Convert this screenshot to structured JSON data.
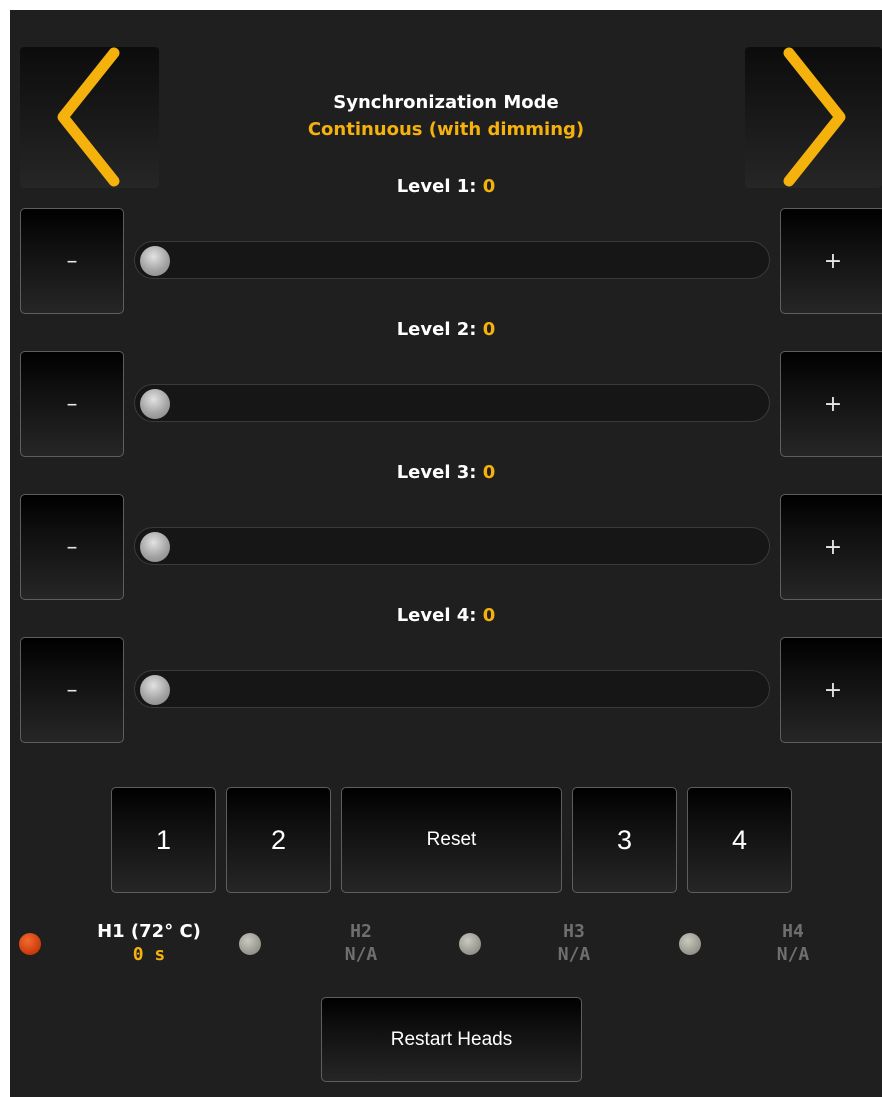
{
  "header": {
    "title": "Synchronization Mode",
    "mode": "Continuous (with dimming)"
  },
  "nav": {
    "prev_icon": "chevron-left-icon",
    "next_icon": "chevron-right-icon",
    "accent_color": "#f5b10c"
  },
  "levels": [
    {
      "label": "Level 1: ",
      "value": "0",
      "position": 0
    },
    {
      "label": "Level 2: ",
      "value": "0",
      "position": 0
    },
    {
      "label": "Level 3: ",
      "value": "0",
      "position": 0
    },
    {
      "label": "Level 4: ",
      "value": "0",
      "position": 0
    }
  ],
  "stepper": {
    "minus": "–",
    "plus": "+"
  },
  "presets": {
    "p1": "1",
    "p2": "2",
    "reset": "Reset",
    "p3": "3",
    "p4": "4"
  },
  "heads": [
    {
      "name": "H1 (72° C)",
      "value": "0 s",
      "status": "active",
      "status_color": "#d8420f"
    },
    {
      "name": "H2",
      "value": "N/A",
      "status": "inactive",
      "status_color": "#a8a89e"
    },
    {
      "name": "H3",
      "value": "N/A",
      "status": "inactive",
      "status_color": "#a8a89e"
    },
    {
      "name": "H4",
      "value": "N/A",
      "status": "inactive",
      "status_color": "#a8a89e"
    }
  ],
  "footer": {
    "restart": "Restart Heads"
  }
}
